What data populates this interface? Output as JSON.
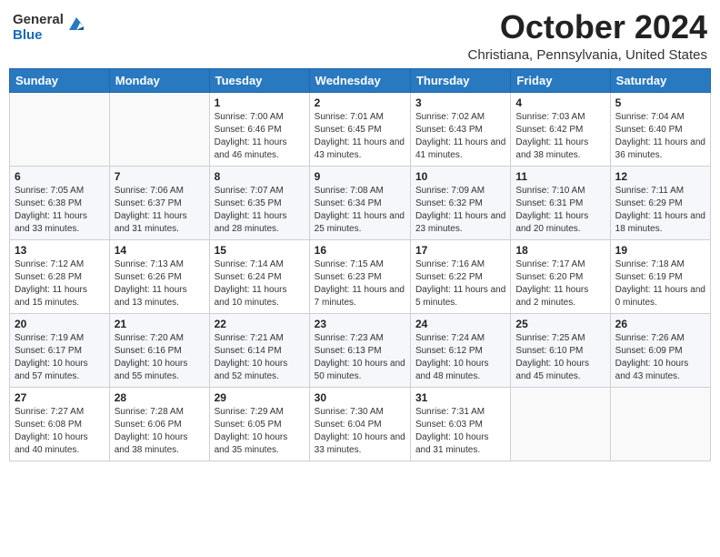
{
  "logo": {
    "general": "General",
    "blue": "Blue"
  },
  "header": {
    "month": "October 2024",
    "location": "Christiana, Pennsylvania, United States"
  },
  "weekdays": [
    "Sunday",
    "Monday",
    "Tuesday",
    "Wednesday",
    "Thursday",
    "Friday",
    "Saturday"
  ],
  "weeks": [
    [
      {
        "day": "",
        "sunrise": "",
        "sunset": "",
        "daylight": ""
      },
      {
        "day": "",
        "sunrise": "",
        "sunset": "",
        "daylight": ""
      },
      {
        "day": "1",
        "sunrise": "Sunrise: 7:00 AM",
        "sunset": "Sunset: 6:46 PM",
        "daylight": "Daylight: 11 hours and 46 minutes."
      },
      {
        "day": "2",
        "sunrise": "Sunrise: 7:01 AM",
        "sunset": "Sunset: 6:45 PM",
        "daylight": "Daylight: 11 hours and 43 minutes."
      },
      {
        "day": "3",
        "sunrise": "Sunrise: 7:02 AM",
        "sunset": "Sunset: 6:43 PM",
        "daylight": "Daylight: 11 hours and 41 minutes."
      },
      {
        "day": "4",
        "sunrise": "Sunrise: 7:03 AM",
        "sunset": "Sunset: 6:42 PM",
        "daylight": "Daylight: 11 hours and 38 minutes."
      },
      {
        "day": "5",
        "sunrise": "Sunrise: 7:04 AM",
        "sunset": "Sunset: 6:40 PM",
        "daylight": "Daylight: 11 hours and 36 minutes."
      }
    ],
    [
      {
        "day": "6",
        "sunrise": "Sunrise: 7:05 AM",
        "sunset": "Sunset: 6:38 PM",
        "daylight": "Daylight: 11 hours and 33 minutes."
      },
      {
        "day": "7",
        "sunrise": "Sunrise: 7:06 AM",
        "sunset": "Sunset: 6:37 PM",
        "daylight": "Daylight: 11 hours and 31 minutes."
      },
      {
        "day": "8",
        "sunrise": "Sunrise: 7:07 AM",
        "sunset": "Sunset: 6:35 PM",
        "daylight": "Daylight: 11 hours and 28 minutes."
      },
      {
        "day": "9",
        "sunrise": "Sunrise: 7:08 AM",
        "sunset": "Sunset: 6:34 PM",
        "daylight": "Daylight: 11 hours and 25 minutes."
      },
      {
        "day": "10",
        "sunrise": "Sunrise: 7:09 AM",
        "sunset": "Sunset: 6:32 PM",
        "daylight": "Daylight: 11 hours and 23 minutes."
      },
      {
        "day": "11",
        "sunrise": "Sunrise: 7:10 AM",
        "sunset": "Sunset: 6:31 PM",
        "daylight": "Daylight: 11 hours and 20 minutes."
      },
      {
        "day": "12",
        "sunrise": "Sunrise: 7:11 AM",
        "sunset": "Sunset: 6:29 PM",
        "daylight": "Daylight: 11 hours and 18 minutes."
      }
    ],
    [
      {
        "day": "13",
        "sunrise": "Sunrise: 7:12 AM",
        "sunset": "Sunset: 6:28 PM",
        "daylight": "Daylight: 11 hours and 15 minutes."
      },
      {
        "day": "14",
        "sunrise": "Sunrise: 7:13 AM",
        "sunset": "Sunset: 6:26 PM",
        "daylight": "Daylight: 11 hours and 13 minutes."
      },
      {
        "day": "15",
        "sunrise": "Sunrise: 7:14 AM",
        "sunset": "Sunset: 6:24 PM",
        "daylight": "Daylight: 11 hours and 10 minutes."
      },
      {
        "day": "16",
        "sunrise": "Sunrise: 7:15 AM",
        "sunset": "Sunset: 6:23 PM",
        "daylight": "Daylight: 11 hours and 7 minutes."
      },
      {
        "day": "17",
        "sunrise": "Sunrise: 7:16 AM",
        "sunset": "Sunset: 6:22 PM",
        "daylight": "Daylight: 11 hours and 5 minutes."
      },
      {
        "day": "18",
        "sunrise": "Sunrise: 7:17 AM",
        "sunset": "Sunset: 6:20 PM",
        "daylight": "Daylight: 11 hours and 2 minutes."
      },
      {
        "day": "19",
        "sunrise": "Sunrise: 7:18 AM",
        "sunset": "Sunset: 6:19 PM",
        "daylight": "Daylight: 11 hours and 0 minutes."
      }
    ],
    [
      {
        "day": "20",
        "sunrise": "Sunrise: 7:19 AM",
        "sunset": "Sunset: 6:17 PM",
        "daylight": "Daylight: 10 hours and 57 minutes."
      },
      {
        "day": "21",
        "sunrise": "Sunrise: 7:20 AM",
        "sunset": "Sunset: 6:16 PM",
        "daylight": "Daylight: 10 hours and 55 minutes."
      },
      {
        "day": "22",
        "sunrise": "Sunrise: 7:21 AM",
        "sunset": "Sunset: 6:14 PM",
        "daylight": "Daylight: 10 hours and 52 minutes."
      },
      {
        "day": "23",
        "sunrise": "Sunrise: 7:23 AM",
        "sunset": "Sunset: 6:13 PM",
        "daylight": "Daylight: 10 hours and 50 minutes."
      },
      {
        "day": "24",
        "sunrise": "Sunrise: 7:24 AM",
        "sunset": "Sunset: 6:12 PM",
        "daylight": "Daylight: 10 hours and 48 minutes."
      },
      {
        "day": "25",
        "sunrise": "Sunrise: 7:25 AM",
        "sunset": "Sunset: 6:10 PM",
        "daylight": "Daylight: 10 hours and 45 minutes."
      },
      {
        "day": "26",
        "sunrise": "Sunrise: 7:26 AM",
        "sunset": "Sunset: 6:09 PM",
        "daylight": "Daylight: 10 hours and 43 minutes."
      }
    ],
    [
      {
        "day": "27",
        "sunrise": "Sunrise: 7:27 AM",
        "sunset": "Sunset: 6:08 PM",
        "daylight": "Daylight: 10 hours and 40 minutes."
      },
      {
        "day": "28",
        "sunrise": "Sunrise: 7:28 AM",
        "sunset": "Sunset: 6:06 PM",
        "daylight": "Daylight: 10 hours and 38 minutes."
      },
      {
        "day": "29",
        "sunrise": "Sunrise: 7:29 AM",
        "sunset": "Sunset: 6:05 PM",
        "daylight": "Daylight: 10 hours and 35 minutes."
      },
      {
        "day": "30",
        "sunrise": "Sunrise: 7:30 AM",
        "sunset": "Sunset: 6:04 PM",
        "daylight": "Daylight: 10 hours and 33 minutes."
      },
      {
        "day": "31",
        "sunrise": "Sunrise: 7:31 AM",
        "sunset": "Sunset: 6:03 PM",
        "daylight": "Daylight: 10 hours and 31 minutes."
      },
      {
        "day": "",
        "sunrise": "",
        "sunset": "",
        "daylight": ""
      },
      {
        "day": "",
        "sunrise": "",
        "sunset": "",
        "daylight": ""
      }
    ]
  ]
}
